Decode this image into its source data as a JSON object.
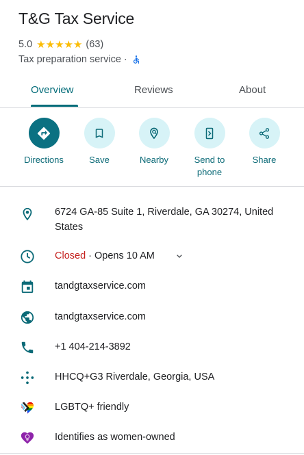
{
  "place": {
    "name": "T&G Tax Service",
    "rating": "5.0",
    "stars": "★★★★★",
    "review_count": "(63)",
    "category": "Tax preparation service",
    "separator": "·"
  },
  "tabs": [
    {
      "label": "Overview",
      "active": true
    },
    {
      "label": "Reviews",
      "active": false
    },
    {
      "label": "About",
      "active": false
    }
  ],
  "actions": [
    {
      "label": "Directions",
      "icon": "directions-icon"
    },
    {
      "label": "Save",
      "icon": "bookmark-icon"
    },
    {
      "label": "Nearby",
      "icon": "nearby-icon"
    },
    {
      "label": "Send to phone",
      "icon": "send-to-phone-icon"
    },
    {
      "label": "Share",
      "icon": "share-icon"
    }
  ],
  "info": {
    "address": "6724 GA-85 Suite 1, Riverdale, GA 30274, United States",
    "hours_status": "Closed",
    "hours_detail": " · Opens 10 AM",
    "booking_site": "tandgtaxservice.com",
    "website": "tandgtaxservice.com",
    "phone": "+1 404-214-3892",
    "plus_code": "HHCQ+G3 Riverdale, Georgia, USA",
    "lgbtq": "LGBTQ+ friendly",
    "women_owned": "Identifies as women-owned"
  },
  "colors": {
    "accent": "#006b78",
    "action_bg": "#d7f3f7",
    "primary_action": "#0b7182",
    "closed": "#c5221f",
    "star": "#fbbc04",
    "women_owned_heart": "#8e24aa"
  }
}
